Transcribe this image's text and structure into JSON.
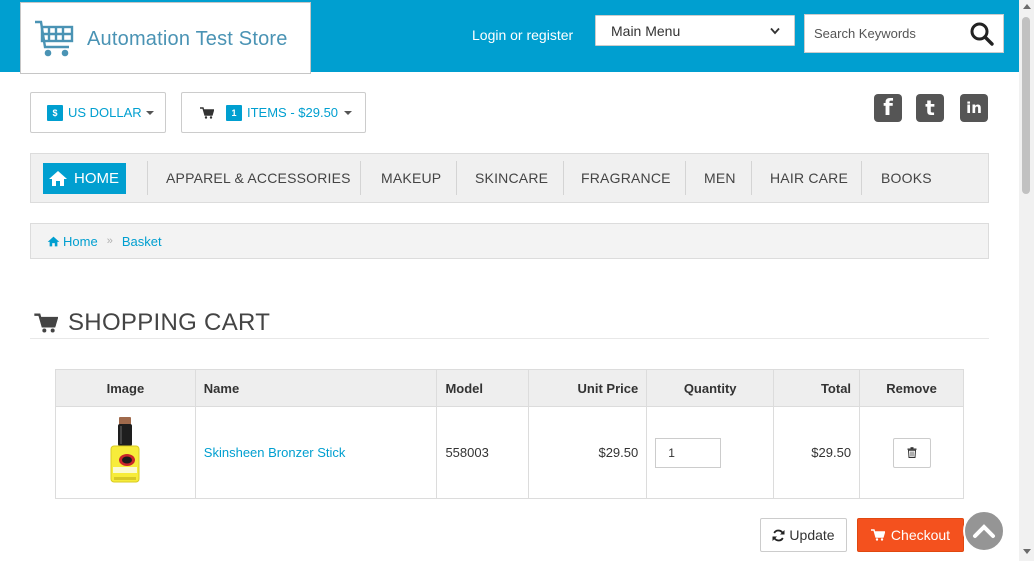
{
  "header": {
    "logo_text": "Automation Test Store",
    "login_label": "Login or register",
    "main_menu_value": "Main Menu",
    "search_placeholder": "Search Keywords"
  },
  "toolbar": {
    "currency_symbol": "$",
    "currency_label": "US DOLLAR",
    "cart_count": "1",
    "cart_label": "ITEMS - $29.50"
  },
  "social": [
    "facebook-icon",
    "twitter-icon",
    "linkedin-icon"
  ],
  "nav": {
    "home": "HOME",
    "items": [
      "APPAREL & ACCESSORIES",
      "MAKEUP",
      "SKINCARE",
      "FRAGRANCE",
      "MEN",
      "HAIR CARE",
      "BOOKS"
    ]
  },
  "breadcrumb": {
    "home": "Home",
    "current": "Basket"
  },
  "cart": {
    "title": "SHOPPING CART",
    "columns": [
      "Image",
      "Name",
      "Model",
      "Unit Price",
      "Quantity",
      "Total",
      "Remove"
    ],
    "rows": [
      {
        "name": "Skinsheen Bronzer Stick",
        "model": "558003",
        "unit_price": "$29.50",
        "quantity": "1",
        "total": "$29.50"
      }
    ],
    "update_label": "Update",
    "checkout_label": "Checkout"
  },
  "colors": {
    "brand": "#009fd0",
    "checkout": "#f4511e"
  }
}
